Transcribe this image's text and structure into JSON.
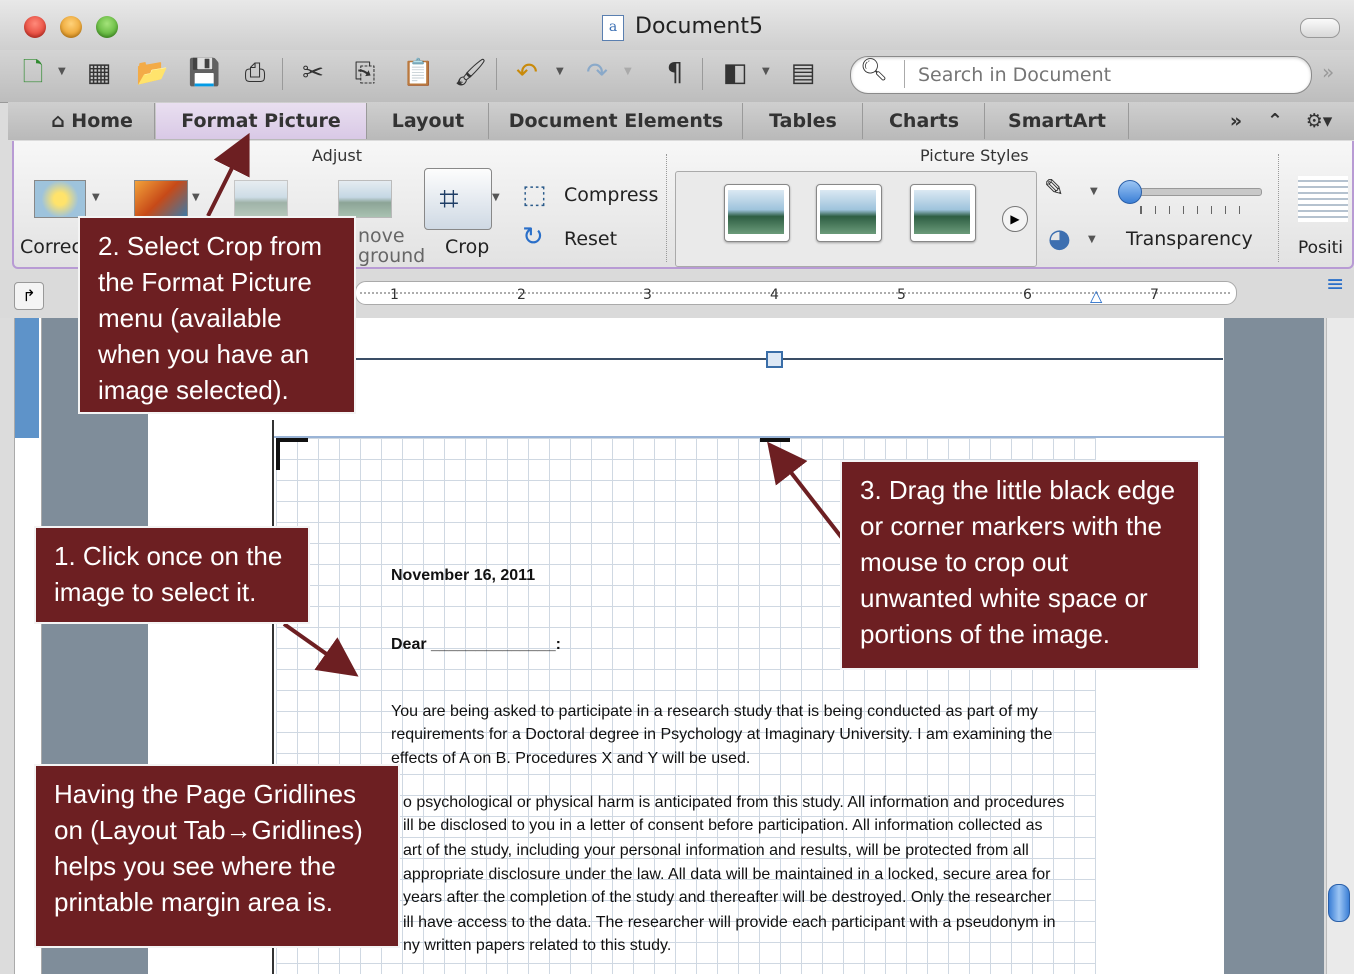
{
  "window": {
    "title": "Document5",
    "doc_icon": "a"
  },
  "toolbar": {
    "search_placeholder": "Search in Document",
    "icons": [
      "new-document-icon",
      "templates-icon",
      "open-icon",
      "save-icon",
      "print-icon",
      "cut-icon",
      "copy-icon",
      "paste-icon",
      "format-painter-icon",
      "undo-icon",
      "redo-icon",
      "pilcrow-icon",
      "sidebar-icon",
      "view-icon",
      "search-icon"
    ]
  },
  "tabs": {
    "home": "Home",
    "format_picture": "Format Picture",
    "layout": "Layout",
    "document_elements": "Document Elements",
    "tables": "Tables",
    "charts": "Charts",
    "smartart": "SmartArt",
    "more": "»"
  },
  "ribbon": {
    "adjust_label": "Adjust",
    "picture_styles_label": "Picture Styles",
    "corrections": "Correc",
    "remove_background": "nove\nground",
    "crop": "Crop",
    "compress": "Compress",
    "reset": "Reset",
    "transparency": "Transparency",
    "position": "Positi"
  },
  "ruler": {
    "ticks": [
      "1",
      "2",
      "3",
      "4",
      "5",
      "6",
      "7"
    ]
  },
  "document": {
    "date": "November 16, 2011",
    "salutation": "Dear ______________:",
    "paragraph1": [
      "You are being asked to participate in a research study that is being conducted as part of my",
      "requirements for a Doctoral degree in Psychology at Imaginary University.  I am examining the",
      "effects of A on B. Procedures X and Y will be used."
    ],
    "paragraph2": [
      "o psychological or physical harm is anticipated from this study. All information and procedures",
      "ill be disclosed to you in a letter of consent before participation.  All information collected as",
      "art of the study, including your personal information and results, will be protected from all",
      "appropriate disclosure under the law.  All data will be maintained in a locked, secure area for",
      "years after the completion of the study and thereafter will be destroyed.  Only the researcher",
      "ill have access to the data.  The researcher will provide each participant with a pseudonym in",
      "ny written papers related to this study."
    ]
  },
  "callouts": {
    "step1": "1. Click once on the image to select it.",
    "step2": "2. Select Crop from the Format Picture menu (available when you have an image selected).",
    "step3": "3. Drag the little black edge or corner markers with the mouse to crop out unwanted white space or portions of the image.",
    "gridlines": "Having the Page Gridlines on (Layout Tab→Gridlines) helps you see where the printable margin area is."
  },
  "colors": {
    "callout_bg": "#6d1f22",
    "ribbon_accent": "#b89bd4"
  }
}
